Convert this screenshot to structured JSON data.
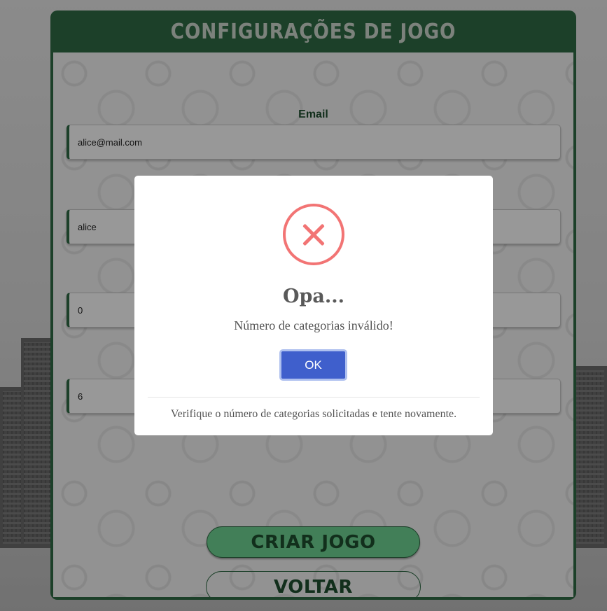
{
  "panel": {
    "title": "CONFIGURAÇÕES DE JOGO"
  },
  "form": {
    "email_label": "Email",
    "email_value": "alice@mail.com",
    "name_value": "alice",
    "field3_value": "0",
    "field4_value": "6"
  },
  "buttons": {
    "create_label": "CRIAR JOGO",
    "back_label": "VOLTAR"
  },
  "dialog": {
    "icon": "error-x-icon",
    "title": "Opa...",
    "message": "Número de categorias inválido!",
    "ok_label": "OK",
    "footer": "Verifique o número de categorias solicitadas e tente novamente."
  },
  "colors": {
    "primary_green": "#2f6b45",
    "button_green": "#6fd493",
    "error_red": "#f27474",
    "ok_blue": "#3f5fcc"
  }
}
